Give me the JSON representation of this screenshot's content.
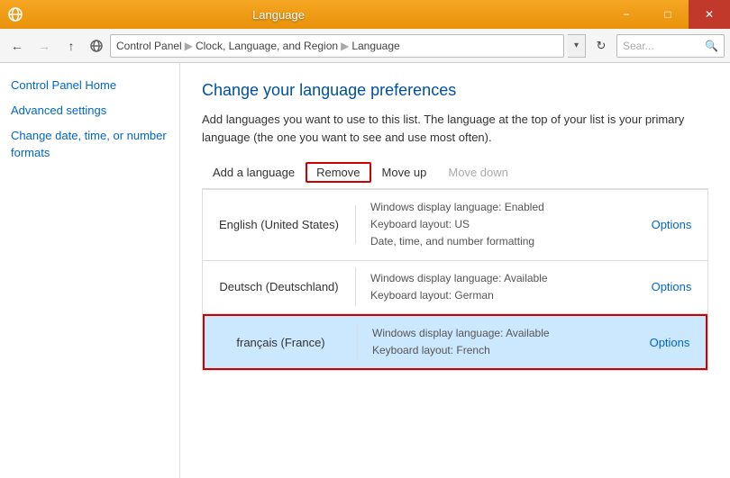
{
  "titlebar": {
    "title": "Language",
    "icon": "🌐",
    "min_label": "−",
    "max_label": "□",
    "close_label": "✕"
  },
  "addressbar": {
    "back_arrow": "←",
    "forward_arrow": "→",
    "up_arrow": "↑",
    "icon": "🌐",
    "path": {
      "part1": "Control Panel",
      "sep1": "▶",
      "part2": "Clock, Language, and Region",
      "sep2": "▶",
      "part3": "Language"
    },
    "dropdown_arrow": "▾",
    "refresh": "↻",
    "search_placeholder": "Sear...",
    "search_icon": "🔍"
  },
  "sidebar": {
    "home_link": "Control Panel Home",
    "links": [
      {
        "id": "advanced-settings",
        "label": "Advanced settings"
      },
      {
        "id": "change-date-time",
        "label": "Change date, time, or number formats"
      }
    ]
  },
  "content": {
    "title": "Change your language preferences",
    "description": "Add languages you want to use to this list. The language at the top of your list is your primary language (the one you want to see and use most often).",
    "toolbar": {
      "add_label": "Add a language",
      "remove_label": "Remove",
      "move_up_label": "Move up",
      "move_down_label": "Move down"
    },
    "languages": [
      {
        "id": "english",
        "name": "English (United States)",
        "info_line1": "Windows display language: Enabled",
        "info_line2": "Keyboard layout: US",
        "info_line3": "Date, time, and number formatting",
        "options_label": "Options",
        "selected": false
      },
      {
        "id": "deutsch",
        "name": "Deutsch (Deutschland)",
        "info_line1": "Windows display language: Available",
        "info_line2": "Keyboard layout: German",
        "info_line3": "",
        "options_label": "Options",
        "selected": false
      },
      {
        "id": "francais",
        "name": "français (France)",
        "info_line1": "Windows display language: Available",
        "info_line2": "Keyboard layout: French",
        "info_line3": "",
        "options_label": "Options",
        "selected": true
      }
    ]
  }
}
